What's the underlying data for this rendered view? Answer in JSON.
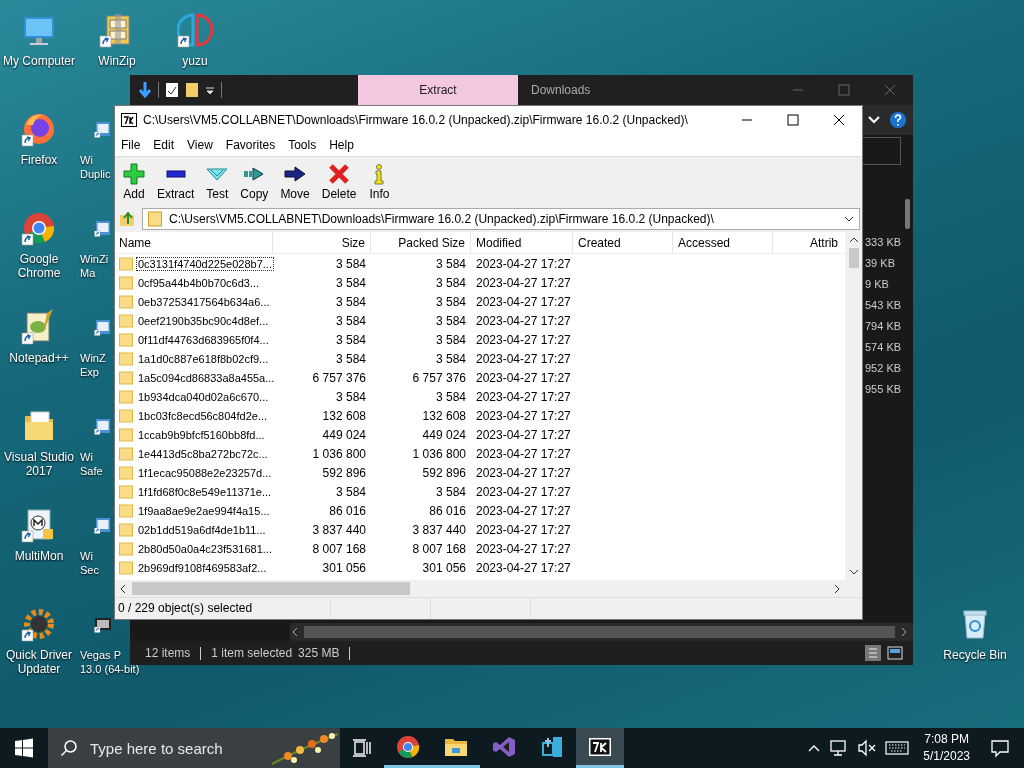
{
  "desktop": {
    "columns": [
      [
        {
          "lines": [
            "My Computer"
          ],
          "kind": "computer",
          "shortcut": false,
          "partial": false
        },
        {
          "lines": [
            "Firefox"
          ],
          "kind": "firefox",
          "shortcut": true,
          "partial": false
        },
        {
          "lines": [
            "Google",
            "Chrome"
          ],
          "kind": "chrome",
          "shortcut": true,
          "partial": false
        },
        {
          "lines": [
            "Notepad++"
          ],
          "kind": "notepad",
          "shortcut": true,
          "partial": false
        },
        {
          "lines": [
            "Visual Studio",
            "2017"
          ],
          "kind": "folder",
          "shortcut": false,
          "partial": false
        },
        {
          "lines": [
            "MultiMon"
          ],
          "kind": "multimon",
          "shortcut": true,
          "partial": false
        },
        {
          "lines": [
            "Quick Driver",
            "Updater"
          ],
          "kind": "driver",
          "shortcut": true,
          "partial": false
        }
      ],
      [
        {
          "lines": [
            "WinZip"
          ],
          "kind": "winzip",
          "shortcut": true,
          "partial": false
        },
        {
          "lines": [
            "Wi",
            "Duplic"
          ],
          "kind": "app",
          "shortcut": true,
          "partial": true
        },
        {
          "lines": [
            "WinZi",
            "Ma"
          ],
          "kind": "app",
          "shortcut": true,
          "partial": true
        },
        {
          "lines": [
            "WinZ",
            "Exp"
          ],
          "kind": "app",
          "shortcut": true,
          "partial": true
        },
        {
          "lines": [
            "Wi",
            "Safe"
          ],
          "kind": "app",
          "shortcut": true,
          "partial": true
        },
        {
          "lines": [
            "Wi",
            "Sec"
          ],
          "kind": "app",
          "shortcut": true,
          "partial": true
        },
        {
          "lines": [
            "Vegas P",
            "13.0 (64-bit)"
          ],
          "kind": "vegas",
          "shortcut": true,
          "partial": true
        }
      ],
      [
        {
          "lines": [
            "yuzu"
          ],
          "kind": "yuzu",
          "shortcut": true,
          "partial": false
        }
      ]
    ],
    "recycle_bin": {
      "lines": [
        "Recycle Bin"
      ],
      "kind": "recycle",
      "shortcut": false,
      "partial": false
    }
  },
  "explorer_window": {
    "ribbon_tab": "Extract",
    "title": "Downloads",
    "size_values": [
      "333 KB",
      "39 KB",
      "9 KB",
      "543 KB",
      "794 KB",
      "574 KB",
      "952 KB",
      "955 KB"
    ],
    "status_items": "12 items",
    "status_selection": "1 item selected",
    "status_size": "325 MB"
  },
  "archive_window": {
    "title": "C:\\Users\\VM5.COLLABNET\\Downloads\\Firmware 16.0.2 (Unpacked).zip\\Firmware 16.0.2 (Unpacked)\\",
    "menu": [
      "File",
      "Edit",
      "View",
      "Favorites",
      "Tools",
      "Help"
    ],
    "toolbar": [
      {
        "label": "Add",
        "kind": "add"
      },
      {
        "label": "Extract",
        "kind": "extract"
      },
      {
        "label": "Test",
        "kind": "test"
      },
      {
        "label": "Copy",
        "kind": "copy"
      },
      {
        "label": "Move",
        "kind": "move"
      },
      {
        "label": "Delete",
        "kind": "delete"
      },
      {
        "label": "Info",
        "kind": "info"
      }
    ],
    "address": "C:\\Users\\VM5.COLLABNET\\Downloads\\Firmware 16.0.2 (Unpacked).zip\\Firmware 16.0.2 (Unpacked)\\",
    "columns": [
      "Name",
      "Size",
      "Packed Size",
      "Modified",
      "Created",
      "Accessed",
      "Attrib"
    ],
    "rows": [
      {
        "name": "0c3131f4740d225e028b7...",
        "size": "3 584",
        "packed_size": "3 584",
        "modified": "2023-04-27 17:27",
        "focused": true
      },
      {
        "name": "0cf95a44b4b0b70c6d3...",
        "size": "3 584",
        "packed_size": "3 584",
        "modified": "2023-04-27 17:27",
        "focused": false
      },
      {
        "name": "0eb37253417564b634a6...",
        "size": "3 584",
        "packed_size": "3 584",
        "modified": "2023-04-27 17:27",
        "focused": false
      },
      {
        "name": "0eef2190b35bc90c4d8ef...",
        "size": "3 584",
        "packed_size": "3 584",
        "modified": "2023-04-27 17:27",
        "focused": false
      },
      {
        "name": "0f11df44763d683965f0f4...",
        "size": "3 584",
        "packed_size": "3 584",
        "modified": "2023-04-27 17:27",
        "focused": false
      },
      {
        "name": "1a1d0c887e618f8b02cf9...",
        "size": "3 584",
        "packed_size": "3 584",
        "modified": "2023-04-27 17:27",
        "focused": false
      },
      {
        "name": "1a5c094cd86833a8a455a...",
        "size": "6 757 376",
        "packed_size": "6 757 376",
        "modified": "2023-04-27 17:27",
        "focused": false
      },
      {
        "name": "1b934dca040d02a6c670...",
        "size": "3 584",
        "packed_size": "3 584",
        "modified": "2023-04-27 17:27",
        "focused": false
      },
      {
        "name": "1bc03fc8ecd56c804fd2e...",
        "size": "132 608",
        "packed_size": "132 608",
        "modified": "2023-04-27 17:27",
        "focused": false
      },
      {
        "name": "1ccab9b9bfcf5160bb8fd...",
        "size": "449 024",
        "packed_size": "449 024",
        "modified": "2023-04-27 17:27",
        "focused": false
      },
      {
        "name": "1e4413d5c8ba272bc72c...",
        "size": "1 036 800",
        "packed_size": "1 036 800",
        "modified": "2023-04-27 17:27",
        "focused": false
      },
      {
        "name": "1f1ecac95088e2e23257d...",
        "size": "592 896",
        "packed_size": "592 896",
        "modified": "2023-04-27 17:27",
        "focused": false
      },
      {
        "name": "1f1fd68f0c8e549e11371e...",
        "size": "3 584",
        "packed_size": "3 584",
        "modified": "2023-04-27 17:27",
        "focused": false
      },
      {
        "name": "1f9aa8ae9e2ae994f4a15...",
        "size": "86 016",
        "packed_size": "86 016",
        "modified": "2023-04-27 17:27",
        "focused": false
      },
      {
        "name": "02b1dd519a6df4de1b11...",
        "size": "3 837 440",
        "packed_size": "3 837 440",
        "modified": "2023-04-27 17:27",
        "focused": false
      },
      {
        "name": "2b80d50a0a4c23f531681...",
        "size": "8 007 168",
        "packed_size": "8 007 168",
        "modified": "2023-04-27 17:27",
        "focused": false
      },
      {
        "name": "2b969df9108f469583af2...",
        "size": "301 056",
        "packed_size": "301 056",
        "modified": "2023-04-27 17:27",
        "focused": false
      }
    ],
    "status": "0 / 229 object(s) selected"
  },
  "taskbar": {
    "search_placeholder": "Type here to search",
    "apps": [
      {
        "kind": "browser",
        "running": true,
        "active": false
      },
      {
        "kind": "files",
        "running": true,
        "active": false
      },
      {
        "kind": "studio",
        "running": false,
        "active": false
      },
      {
        "kind": "designer",
        "running": false,
        "active": false
      },
      {
        "kind": "archiver",
        "running": true,
        "active": true
      }
    ],
    "time": "7:08 PM",
    "date": "5/1/2023"
  }
}
